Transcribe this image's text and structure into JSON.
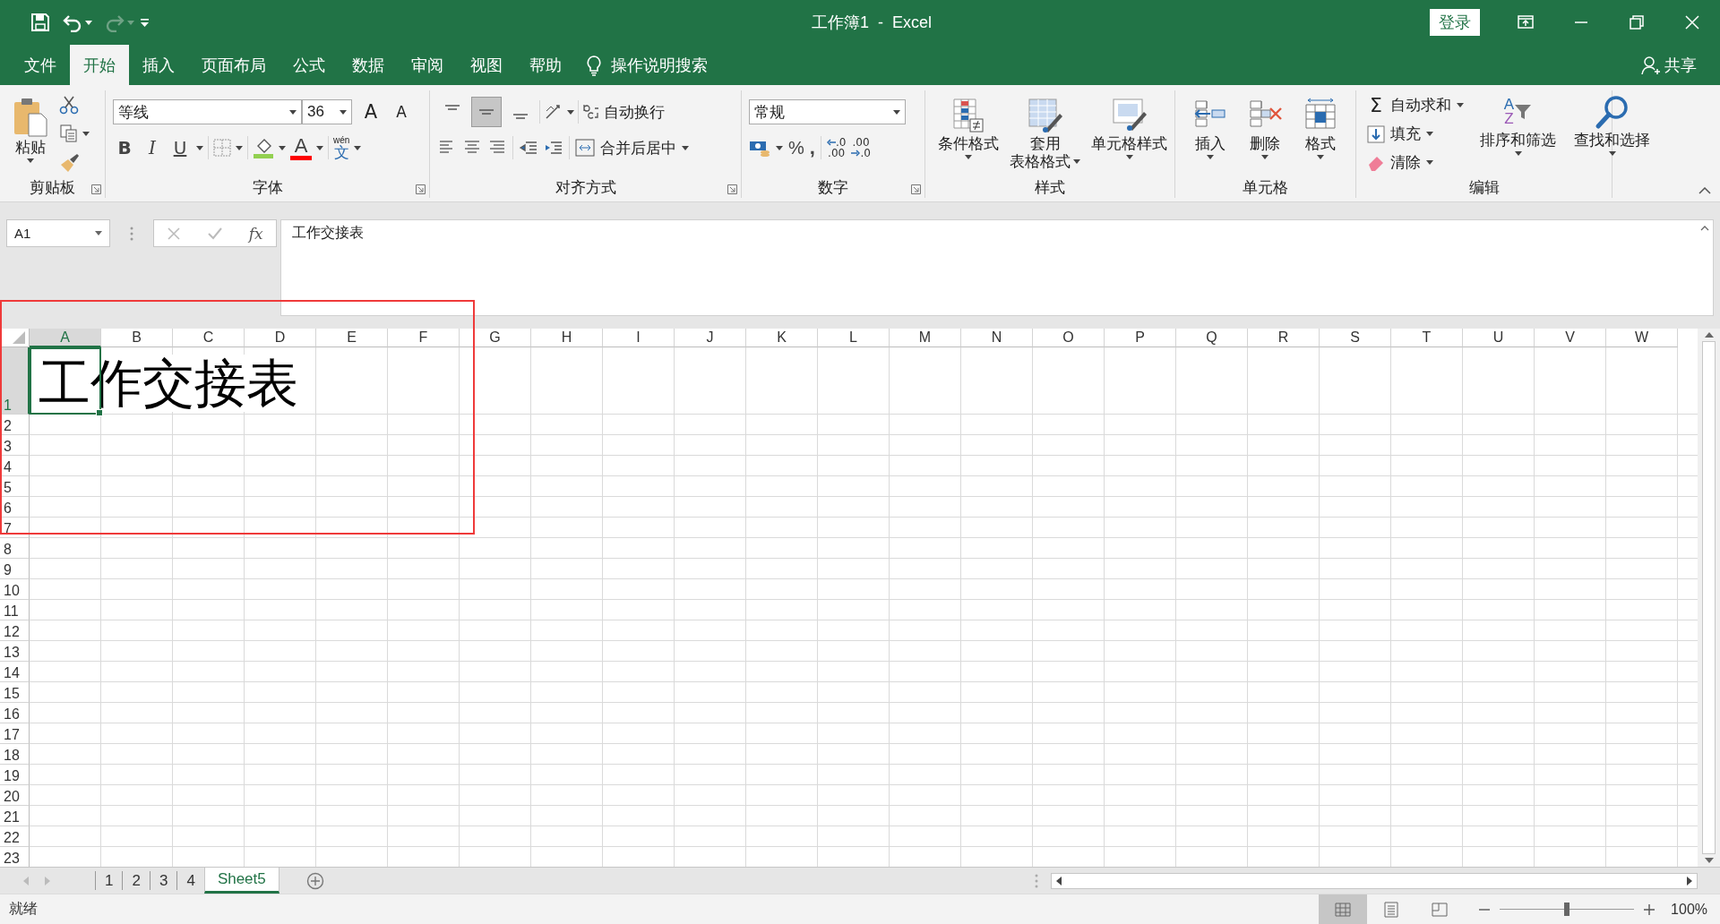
{
  "window": {
    "title": "工作簿1  -  Excel",
    "sign_in": "登录"
  },
  "quick_access": [
    {
      "kind": "save",
      "disabled": false
    },
    {
      "kind": "undo",
      "disabled": false
    },
    {
      "kind": "redo",
      "disabled": true
    }
  ],
  "menu_tabs": [
    {
      "label": "文件",
      "selected": false
    },
    {
      "label": "开始",
      "selected": true
    },
    {
      "label": "插入",
      "selected": false
    },
    {
      "label": "页面布局",
      "selected": false
    },
    {
      "label": "公式",
      "selected": false
    },
    {
      "label": "数据",
      "selected": false
    },
    {
      "label": "审阅",
      "selected": false
    },
    {
      "label": "视图",
      "selected": false
    },
    {
      "label": "帮助",
      "selected": false
    }
  ],
  "tell_me": "操作说明搜索",
  "share": "共享",
  "ribbon": {
    "clipboard": {
      "label": "剪贴板",
      "paste": "粘贴"
    },
    "font": {
      "label": "字体",
      "font_name": "等线",
      "font_size": "36",
      "grow": "A",
      "shrink": "A",
      "bold": "B",
      "italic": "I",
      "underline": "U",
      "font_color": "A",
      "phonetic_ruby": "wén",
      "phonetic": "文"
    },
    "alignment": {
      "label": "对齐方式",
      "vertical": [
        {
          "kind": "top",
          "selected": false
        },
        {
          "kind": "middle",
          "selected": true
        },
        {
          "kind": "bottom",
          "selected": false
        }
      ],
      "wrap_text": "自动换行",
      "merge": "合并后居中"
    },
    "number": {
      "label": "数字",
      "format": "常规",
      "percent": "%",
      "comma": ",",
      "decimals": [
        {
          "kind": "increase",
          "top": ".0",
          "bottom": ".00"
        },
        {
          "kind": "decrease",
          "top": ".00",
          "bottom": ".0"
        }
      ]
    },
    "styles": {
      "label": "样式",
      "buttons": [
        {
          "kind": "conditional",
          "lines": [
            "条件格式"
          ]
        },
        {
          "kind": "table",
          "lines": [
            "套用",
            "表格格式"
          ]
        },
        {
          "kind": "cell_styles",
          "lines": [
            "单元格样式"
          ]
        }
      ]
    },
    "cells": {
      "label": "单元格",
      "buttons": [
        {
          "kind": "insert",
          "label": "插入"
        },
        {
          "kind": "delete",
          "label": "删除"
        },
        {
          "kind": "format",
          "label": "格式"
        }
      ]
    },
    "editing": {
      "label": "编辑",
      "autosum_symbol": "Σ",
      "autosum": "自动求和",
      "fill": "填充",
      "clear": "清除",
      "sort": "排序和筛选",
      "sort_letters": [
        "A",
        "Z"
      ],
      "find": "查找和选择"
    }
  },
  "formula_bar": {
    "name_box": "A1",
    "fx": "fx",
    "formula": "工作交接表"
  },
  "sheet": {
    "columns": [
      {
        "label": "A",
        "selected": true
      },
      {
        "label": "B",
        "selected": false
      },
      {
        "label": "C",
        "selected": false
      },
      {
        "label": "D",
        "selected": false
      },
      {
        "label": "E",
        "selected": false
      },
      {
        "label": "F",
        "selected": false
      },
      {
        "label": "G",
        "selected": false
      },
      {
        "label": "H",
        "selected": false
      },
      {
        "label": "I",
        "selected": false
      },
      {
        "label": "J",
        "selected": false
      },
      {
        "label": "K",
        "selected": false
      },
      {
        "label": "L",
        "selected": false
      },
      {
        "label": "M",
        "selected": false
      },
      {
        "label": "N",
        "selected": false
      },
      {
        "label": "O",
        "selected": false
      },
      {
        "label": "P",
        "selected": false
      },
      {
        "label": "Q",
        "selected": false
      },
      {
        "label": "R",
        "selected": false
      },
      {
        "label": "S",
        "selected": false
      },
      {
        "label": "T",
        "selected": false
      },
      {
        "label": "U",
        "selected": false
      },
      {
        "label": "V",
        "selected": false
      },
      {
        "label": "W",
        "selected": false
      }
    ],
    "rows": [
      {
        "label": "1",
        "selected": true,
        "cells": [
          {
            "text": "工作交接表",
            "selected": true
          }
        ]
      },
      {
        "label": "2",
        "selected": false
      },
      {
        "label": "3",
        "selected": false
      },
      {
        "label": "4",
        "selected": false
      },
      {
        "label": "5",
        "selected": false
      },
      {
        "label": "6",
        "selected": false
      },
      {
        "label": "7",
        "selected": false
      },
      {
        "label": "8",
        "selected": false
      },
      {
        "label": "9",
        "selected": false
      },
      {
        "label": "10",
        "selected": false
      },
      {
        "label": "11",
        "selected": false
      },
      {
        "label": "12",
        "selected": false
      },
      {
        "label": "13",
        "selected": false
      },
      {
        "label": "14",
        "selected": false
      },
      {
        "label": "15",
        "selected": false
      },
      {
        "label": "16",
        "selected": false
      },
      {
        "label": "17",
        "selected": false
      },
      {
        "label": "18",
        "selected": false
      },
      {
        "label": "19",
        "selected": false
      },
      {
        "label": "20",
        "selected": false
      },
      {
        "label": "21",
        "selected": false
      },
      {
        "label": "22",
        "selected": false
      },
      {
        "label": "23",
        "selected": false
      }
    ],
    "annotations": [
      {
        "kind": "rectangle"
      }
    ]
  },
  "sheet_tabs": [
    {
      "label": "1",
      "selected": false
    },
    {
      "label": "2",
      "selected": false
    },
    {
      "label": "3",
      "selected": false
    },
    {
      "label": "4",
      "selected": false
    },
    {
      "label": "Sheet5",
      "selected": true
    }
  ],
  "status_bar": {
    "text": "就绪",
    "views": [
      {
        "kind": "normal",
        "selected": true
      },
      {
        "kind": "page_layout",
        "selected": false
      },
      {
        "kind": "page_break",
        "selected": false
      }
    ],
    "zoom": {
      "level": 0.5
    },
    "zoom_text": "100%"
  }
}
